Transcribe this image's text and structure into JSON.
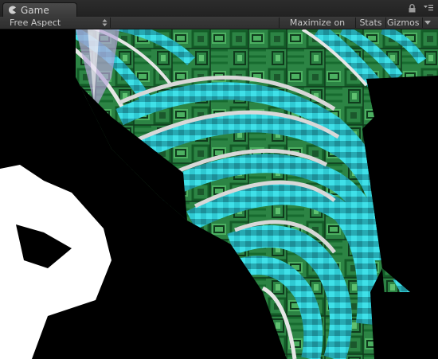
{
  "window": {
    "tab_label": "Game",
    "tab_icon": "pacman-icon",
    "lock_icon": "lock-icon",
    "menu_icon": "menu-icon"
  },
  "toolbar": {
    "aspect_label": "Free Aspect",
    "maximize_label": "Maximize on Play",
    "stats_label": "Stats",
    "gizmos_label": "Gizmos",
    "dropdown_icon": "chevron-down-icon"
  },
  "scene": {
    "colors": {
      "background": "#000000",
      "circuit_green": "#2f8a46",
      "circuit_dark": "#0f3b1c",
      "stripe_cyan": "#2fc9d2",
      "stripe_white": "#e6e6e6",
      "panel_white": "#ffffff"
    }
  }
}
